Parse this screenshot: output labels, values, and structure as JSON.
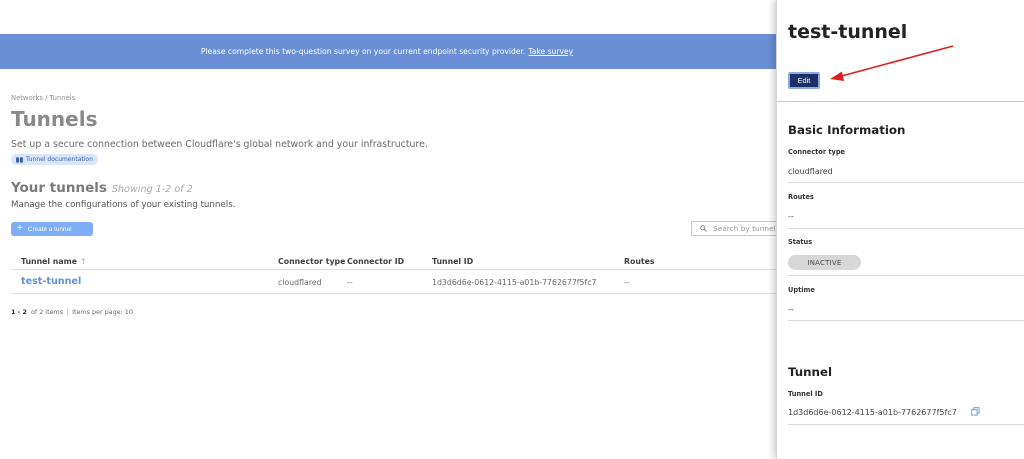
{
  "banner": {
    "message": "Please complete this two-question survey on your current endpoint security provider.",
    "link": "Take survey"
  },
  "breadcrumb": "Networks  /  Tunnels",
  "page": {
    "title": "Tunnels",
    "subtitle": "Set up a secure connection between Cloudflare's global network and your infrastructure.",
    "doc_link": "Tunnel documentation"
  },
  "your_tunnels": {
    "title": "Your tunnels",
    "showing": "Showing 1-2 of 2",
    "subtitle": "Manage the configurations of your existing tunnels.",
    "create_label": "Create a tunnel",
    "search_placeholder": "Search by tunnel"
  },
  "table": {
    "headers": {
      "name": "Tunnel name",
      "connector_type": "Connector type",
      "connector_id": "Connector ID",
      "tunnel_id": "Tunnel ID",
      "routes": "Routes"
    },
    "sort_arrow": "↑",
    "rows": [
      {
        "name": "test-tunnel",
        "connector_type": "cloudflared",
        "connector_id": "--",
        "tunnel_id": "1d3d6d6e-0612-4115-a01b-7762677f5fc7",
        "routes": "--"
      }
    ]
  },
  "pagination": {
    "range": "1 - 2",
    "of": "of 2 items",
    "per_page": "Items per page: 10"
  },
  "panel": {
    "title": "test-tunnel",
    "edit_label": "Edit",
    "basic_info_heading": "Basic Information",
    "connector_type_label": "Connector type",
    "connector_type_value": "cloudflared",
    "routes_label": "Routes",
    "routes_value": "--",
    "status_label": "Status",
    "status_value": "INACTIVE",
    "uptime_label": "Uptime",
    "uptime_value": "--",
    "tunnel_heading": "Tunnel",
    "tunnel_id_label": "Tunnel ID",
    "tunnel_id_value": "1d3d6d6e-0612-4115-a01b-7762677f5fc7"
  },
  "colors": {
    "banner": "#6a8fd6",
    "accent": "#5f92dd",
    "edit_button": "#1c2f66",
    "annotation_arrow": "#e02020"
  },
  "icons": [
    "book-icon",
    "plus-icon",
    "search-icon",
    "copy-icon",
    "red-annotation-arrow"
  ]
}
